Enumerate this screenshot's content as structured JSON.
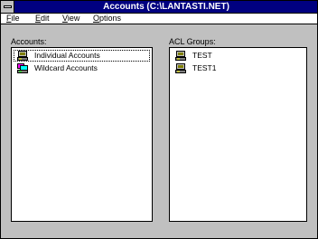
{
  "window": {
    "title": "Accounts (C:\\LANTASTI.NET)"
  },
  "menu": {
    "items": [
      "File",
      "Edit",
      "View",
      "Options"
    ]
  },
  "accounts": {
    "label": "Accounts:",
    "items": [
      {
        "label": "Individual Accounts",
        "icon": "individual-accounts-icon"
      },
      {
        "label": "Wildcard Accounts",
        "icon": "wildcard-accounts-icon"
      }
    ]
  },
  "acl": {
    "label": "ACL Groups:",
    "items": [
      {
        "label": "TEST",
        "icon": "acl-group-icon"
      },
      {
        "label": "TEST1",
        "icon": "acl-group-icon"
      }
    ]
  },
  "colors": {
    "titlebar": "#000080",
    "face": "#c0c0c0",
    "window": "#ffffff"
  }
}
